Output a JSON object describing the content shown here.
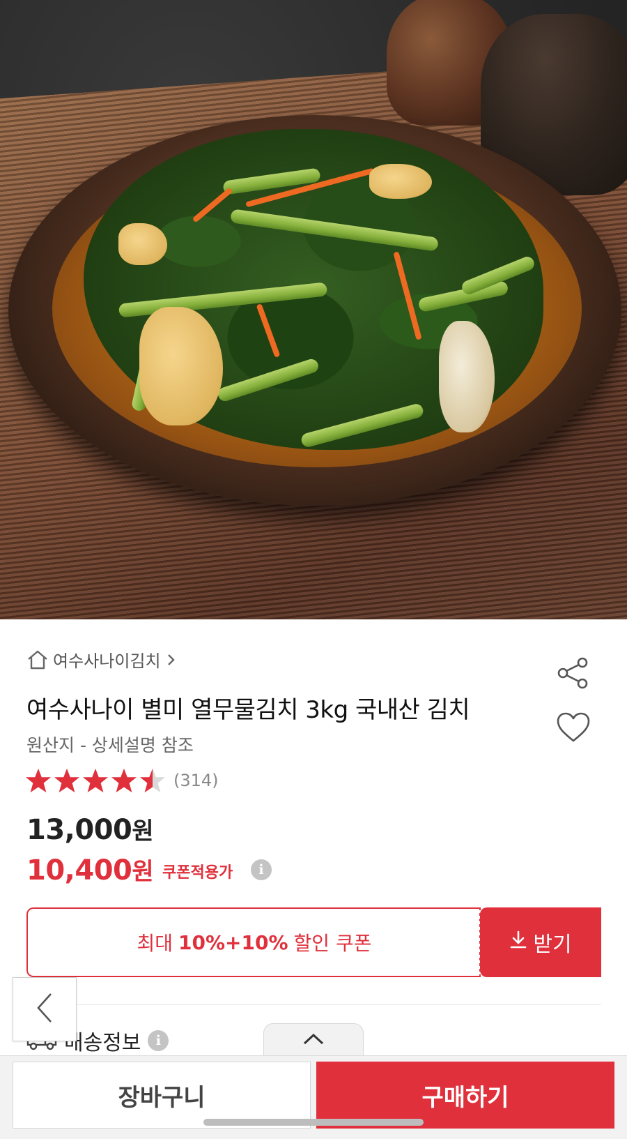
{
  "product": {
    "store_name": "여수사나이김치",
    "title": "여수사나이 별미 열무물김치 3kg 국내산 김치",
    "origin": "원산지 - 상세설명 참조",
    "rating": 4.5,
    "rating_max": 5,
    "review_count": "(314)",
    "original_price": "13,000",
    "sale_price": "10,400",
    "currency": "원",
    "coupon_applied_label": "쿠폰적용가"
  },
  "coupon": {
    "prefix": "최대",
    "amount": "10%+10%",
    "suffix": "할인 쿠폰",
    "download_label": "받기"
  },
  "delivery": {
    "label": "배송정보"
  },
  "bottom_bar": {
    "cart_label": "장바구니",
    "buy_label": "구매하기"
  },
  "colors": {
    "accent": "#e0303c",
    "star": "#e0303c",
    "star_empty": "#d9d9d9"
  },
  "icons": {
    "home": "home-icon",
    "chevron": "chevron-right-icon",
    "share": "share-icon",
    "heart": "heart-icon",
    "info": "info-icon",
    "download": "download-icon",
    "truck": "truck-icon",
    "back": "chevron-left-icon",
    "collapse": "chevron-up-icon"
  }
}
